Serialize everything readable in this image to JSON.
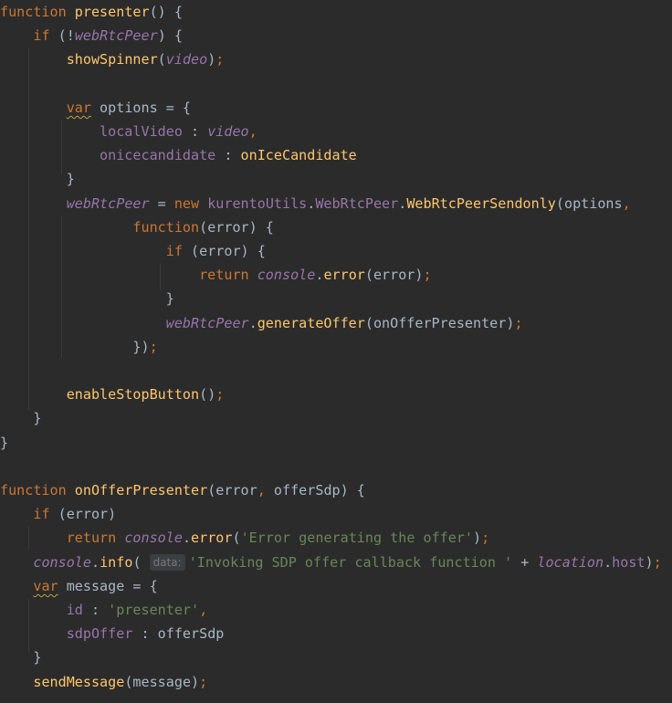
{
  "editor": {
    "lines": [
      [
        {
          "t": "function ",
          "c": "kw"
        },
        {
          "t": "presenter",
          "c": "fn"
        },
        {
          "t": "() {",
          "c": "txt"
        }
      ],
      [
        {
          "t": "    "
        },
        {
          "t": "if ",
          "c": "kw"
        },
        {
          "t": "(!",
          "c": "txt"
        },
        {
          "t": "webRtcPeer",
          "c": "fld"
        },
        {
          "t": ") {",
          "c": "txt"
        }
      ],
      [
        {
          "t": "        "
        },
        {
          "t": "showSpinner",
          "c": "fn"
        },
        {
          "t": "(",
          "c": "txt"
        },
        {
          "t": "video",
          "c": "fld"
        },
        {
          "t": ")",
          "c": "txt"
        },
        {
          "t": ";",
          "c": "punc"
        }
      ],
      [],
      [
        {
          "t": "        "
        },
        {
          "t": "var",
          "c": "kw squig"
        },
        {
          "t": " options = {",
          "c": "txt"
        }
      ],
      [
        {
          "t": "            "
        },
        {
          "t": "localVideo",
          "c": "prop"
        },
        {
          "t": " : ",
          "c": "txt"
        },
        {
          "t": "video",
          "c": "fld"
        },
        {
          "t": ",",
          "c": "punc"
        }
      ],
      [
        {
          "t": "            "
        },
        {
          "t": "onicecandidate",
          "c": "prop"
        },
        {
          "t": " : ",
          "c": "txt"
        },
        {
          "t": "onIceCandidate",
          "c": "fn"
        }
      ],
      [
        {
          "t": "        "
        },
        {
          "t": "}",
          "c": "txt"
        }
      ],
      [
        {
          "t": "        "
        },
        {
          "t": "webRtcPeer",
          "c": "fld"
        },
        {
          "t": " = ",
          "c": "txt"
        },
        {
          "t": "new ",
          "c": "kw"
        },
        {
          "t": "kurentoUtils",
          "c": "prop"
        },
        {
          "t": ".",
          "c": "txt"
        },
        {
          "t": "WebRtcPeer",
          "c": "prop"
        },
        {
          "t": ".",
          "c": "txt"
        },
        {
          "t": "WebRtcPeerSendonly",
          "c": "fn"
        },
        {
          "t": "(options",
          "c": "txt"
        },
        {
          "t": ",",
          "c": "punc"
        }
      ],
      [
        {
          "t": "                "
        },
        {
          "t": "function",
          "c": "kw"
        },
        {
          "t": "(error) {",
          "c": "txt"
        }
      ],
      [
        {
          "t": "                    "
        },
        {
          "t": "if ",
          "c": "kw"
        },
        {
          "t": "(error) {",
          "c": "txt"
        }
      ],
      [
        {
          "t": "                        "
        },
        {
          "t": "return ",
          "c": "kw"
        },
        {
          "t": "console",
          "c": "fld"
        },
        {
          "t": ".",
          "c": "txt"
        },
        {
          "t": "error",
          "c": "fn"
        },
        {
          "t": "(error)",
          "c": "txt"
        },
        {
          "t": ";",
          "c": "punc"
        }
      ],
      [
        {
          "t": "                    "
        },
        {
          "t": "}",
          "c": "txt"
        }
      ],
      [
        {
          "t": "                    "
        },
        {
          "t": "webRtcPeer",
          "c": "fld"
        },
        {
          "t": ".",
          "c": "txt"
        },
        {
          "t": "generateOffer",
          "c": "fn"
        },
        {
          "t": "(onOfferPresenter)",
          "c": "txt"
        },
        {
          "t": ";",
          "c": "punc"
        }
      ],
      [
        {
          "t": "                "
        },
        {
          "t": "})",
          "c": "txt"
        },
        {
          "t": ";",
          "c": "punc"
        }
      ],
      [],
      [
        {
          "t": "        "
        },
        {
          "t": "enableStopButton",
          "c": "fn"
        },
        {
          "t": "()",
          "c": "txt"
        },
        {
          "t": ";",
          "c": "punc"
        }
      ],
      [
        {
          "t": "    "
        },
        {
          "t": "}",
          "c": "txt"
        }
      ],
      [
        {
          "t": "}",
          "c": "txt"
        }
      ],
      [],
      [
        {
          "t": "function ",
          "c": "kw"
        },
        {
          "t": "onOfferPresenter",
          "c": "fn"
        },
        {
          "t": "(error",
          "c": "txt"
        },
        {
          "t": ", ",
          "c": "punc"
        },
        {
          "t": "offerSdp) {",
          "c": "txt"
        }
      ],
      [
        {
          "t": "    "
        },
        {
          "t": "if ",
          "c": "kw"
        },
        {
          "t": "(error)",
          "c": "txt"
        }
      ],
      [
        {
          "t": "        "
        },
        {
          "t": "return ",
          "c": "kw"
        },
        {
          "t": "console",
          "c": "fld"
        },
        {
          "t": ".",
          "c": "txt"
        },
        {
          "t": "error",
          "c": "fn"
        },
        {
          "t": "(",
          "c": "txt"
        },
        {
          "t": "'Error generating the offer'",
          "c": "str"
        },
        {
          "t": ")",
          "c": "txt"
        },
        {
          "t": ";",
          "c": "punc"
        }
      ],
      [
        {
          "t": "    "
        },
        {
          "t": "console",
          "c": "fld"
        },
        {
          "t": ".",
          "c": "txt"
        },
        {
          "t": "info",
          "c": "fn"
        },
        {
          "t": "( ",
          "c": "txt"
        },
        {
          "t": "data:",
          "c": "hint"
        },
        {
          "t": "'Invoking SDP offer callback function '",
          "c": "str"
        },
        {
          "t": " + ",
          "c": "txt"
        },
        {
          "t": "location",
          "c": "fld"
        },
        {
          "t": ".",
          "c": "txt"
        },
        {
          "t": "host",
          "c": "prop"
        },
        {
          "t": ")",
          "c": "txt"
        },
        {
          "t": ";",
          "c": "punc"
        }
      ],
      [
        {
          "t": "    "
        },
        {
          "t": "var",
          "c": "kw squig"
        },
        {
          "t": " message = {",
          "c": "txt"
        }
      ],
      [
        {
          "t": "        "
        },
        {
          "t": "id",
          "c": "prop"
        },
        {
          "t": " : ",
          "c": "txt"
        },
        {
          "t": "'presenter'",
          "c": "str"
        },
        {
          "t": ",",
          "c": "punc"
        }
      ],
      [
        {
          "t": "        "
        },
        {
          "t": "sdpOffer",
          "c": "prop"
        },
        {
          "t": " : offerSdp",
          "c": "txt"
        }
      ],
      [
        {
          "t": "    "
        },
        {
          "t": "}",
          "c": "txt"
        }
      ],
      [
        {
          "t": "    "
        },
        {
          "t": "sendMessage",
          "c": "fn"
        },
        {
          "t": "(message)",
          "c": "txt"
        },
        {
          "t": ";",
          "c": "punc"
        }
      ]
    ]
  }
}
